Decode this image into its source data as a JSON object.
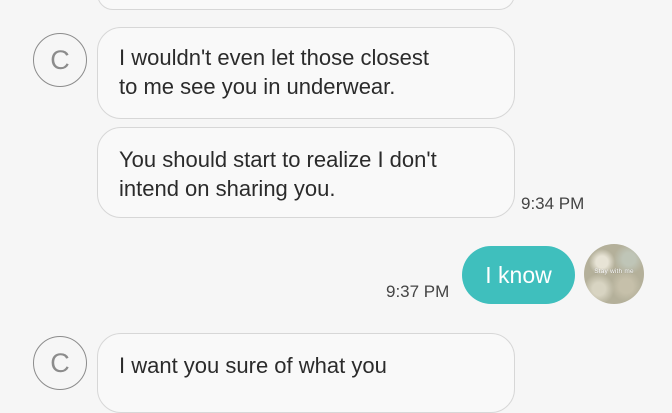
{
  "conversation": {
    "messages": [
      {
        "direction": "received",
        "avatar_letter": "C",
        "text_lines": [
          "I wouldn't even let those closest",
          "to me see you in underwear."
        ]
      },
      {
        "direction": "received",
        "text_lines": [
          "You should start to realize I don't",
          "intend on sharing you."
        ],
        "time": "9:34 PM"
      },
      {
        "direction": "sent",
        "text": "I know",
        "time": "9:37 PM",
        "avatar_text": "Stay with me"
      },
      {
        "direction": "received",
        "avatar_letter": "C",
        "text_lines": [
          "I want you sure of what you"
        ]
      }
    ]
  },
  "colors": {
    "background": "#f6f6f6",
    "received_bubble": "#f9f9f9",
    "received_border": "#d7d7d7",
    "sent_bubble": "#3fbfbd",
    "avatar_border": "#8c8c8c"
  }
}
